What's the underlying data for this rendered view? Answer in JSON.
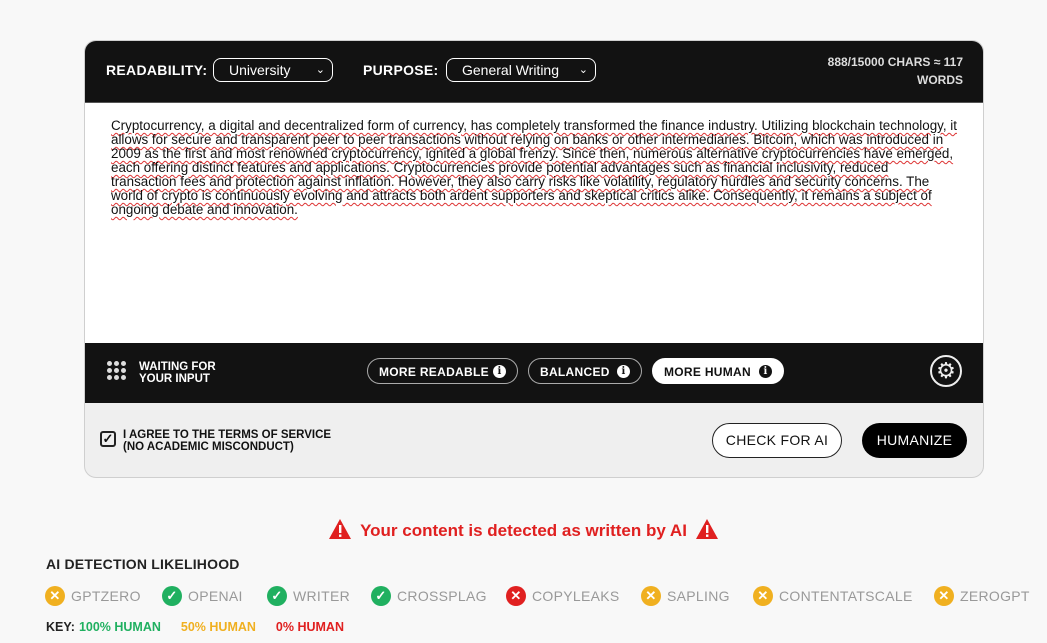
{
  "toolbar": {
    "readability_label": "READABILITY:",
    "readability_value": "University",
    "purpose_label": "PURPOSE:",
    "purpose_value": "General Writing",
    "char_count": "888/15000 CHARS ≈ 117",
    "word_suffix": "WORDS"
  },
  "editor": {
    "text": "Cryptocurrency, a digital and decentralized form of currency, has completely transformed the finance industry. Utilizing blockchain technology, it allows for secure and transparent peer to peer transactions without relying on banks or other intermediaries. Bitcoin, which was introduced in 2009 as the first and most renowned cryptocurrency, ignited a global frenzy. Since then, numerous alternative cryptocurrencies have emerged, each offering distinct features and applications. Cryptocurrencies provide potential advantages such as financial inclusivity, reduced transaction fees and protection against inflation. However, they also carry risks like volatility, regulatory hurdles and security concerns. The world of crypto is continuously evolving and attracts both ardent supporters and skeptical critics alike. Consequently, it remains a subject of ongoing debate and innovation."
  },
  "status": {
    "line1": "WAITING FOR",
    "line2": "YOUR INPUT"
  },
  "modes": [
    {
      "label": "MORE READABLE",
      "active": false
    },
    {
      "label": "BALANCED",
      "active": false
    },
    {
      "label": "MORE HUMAN",
      "active": true
    }
  ],
  "footer": {
    "agree_line1": "I AGREE TO THE TERMS OF SERVICE",
    "agree_line2": "(NO ACADEMIC MISCONDUCT)",
    "check_button": "CHECK FOR AI",
    "humanize_button": "HUMANIZE"
  },
  "alert": "Your content is detected as written by AI",
  "detection": {
    "label": "AI DETECTION LIKELIHOOD",
    "detectors": [
      {
        "name": "GPTZERO",
        "status": "50%",
        "icon": "x-icon"
      },
      {
        "name": "OPENAI",
        "status": "100%",
        "icon": "check-icon"
      },
      {
        "name": "WRITER",
        "status": "100%",
        "icon": "check-icon"
      },
      {
        "name": "CROSSPLAG",
        "status": "100%",
        "icon": "check-icon"
      },
      {
        "name": "COPYLEAKS",
        "status": "0%",
        "icon": "x-icon"
      },
      {
        "name": "SAPLING",
        "status": "50%",
        "icon": "x-icon"
      },
      {
        "name": "CONTENTATSCALE",
        "status": "50%",
        "icon": "x-icon"
      },
      {
        "name": "ZEROGPT",
        "status": "50%",
        "icon": "x-icon"
      }
    ]
  },
  "key": {
    "label": "KEY:",
    "human100": "100% HUMAN",
    "human50": "50% HUMAN",
    "human0": "0% HUMAN"
  },
  "colors": {
    "green": "#20b060",
    "orange": "#f0b020",
    "red": "#e02020"
  }
}
